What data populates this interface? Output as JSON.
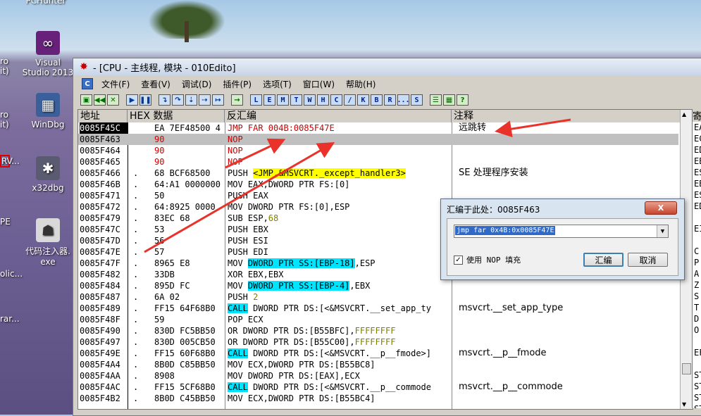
{
  "desktop": {
    "top_label": "PCHunter",
    "icons": [
      {
        "label": "Visual Studio 2013",
        "line1": "Visual",
        "line2": "Studio 2013"
      },
      {
        "label": "WinDbg"
      },
      {
        "label": "x32dbg"
      },
      {
        "label": "代码注入器.exe",
        "line1": "代码注入器.",
        "line2": "exe"
      }
    ],
    "left_edge_labels": [
      "ro",
      "it)",
      "ro",
      "it)",
      "RV...",
      "PE",
      "olic...",
      "rar..."
    ]
  },
  "window": {
    "title": "- [CPU - 主线程, 模块 - 010Edito]",
    "menu": [
      "文件(F)",
      "查看(V)",
      "调试(D)",
      "插件(P)",
      "选项(T)",
      "窗口(W)",
      "帮助(H)"
    ],
    "menu_icon": "C",
    "toolbar_letters": [
      "L",
      "E",
      "M",
      "T",
      "W",
      "H",
      "C",
      "/",
      "K",
      "B",
      "R",
      "...",
      "S"
    ]
  },
  "cpu": {
    "columns": {
      "address": "地址",
      "hex": "HEX 数据",
      "disasm": "反汇编",
      "comment": "注释"
    },
    "registers_header": "寄",
    "registers": [
      "EA",
      "EC",
      "ED",
      "EB",
      "ES",
      "EB",
      "ES",
      "ED",
      "",
      "EI",
      "",
      "C",
      "P",
      "A",
      "Z",
      "S",
      "T",
      "D",
      "O",
      "",
      "EF",
      "",
      "ST",
      "ST",
      "ST",
      "ST"
    ],
    "rows": [
      {
        "addr": "0085F45C",
        "dot": "",
        "hex": "EA 7EF48500 4",
        "dis": [
          {
            "t": "JMP FAR 004B:0085F47E",
            "c": "red"
          }
        ],
        "comment": "远跳转",
        "sel": true
      },
      {
        "addr": "0085F463",
        "dot": "",
        "hex": "90",
        "hexc": "red",
        "dis": [
          {
            "t": "NOP",
            "c": "red"
          }
        ],
        "comment": "",
        "gray": true
      },
      {
        "addr": "0085F464",
        "dot": "",
        "hex": "90",
        "hexc": "red",
        "dis": [
          {
            "t": "NOP",
            "c": "red"
          }
        ],
        "comment": ""
      },
      {
        "addr": "0085F465",
        "dot": "",
        "hex": "90",
        "hexc": "red",
        "dis": [
          {
            "t": "NOP",
            "c": "red"
          }
        ],
        "comment": ""
      },
      {
        "addr": "0085F466",
        "dot": ".",
        "hex": "68 BCF68500",
        "dis": [
          {
            "t": "PUSH "
          },
          {
            "t": "<JMP.&MSVCRT._except_handler3>",
            "c": "hl"
          }
        ],
        "comment": "SE 处理程序安装"
      },
      {
        "addr": "0085F46B",
        "dot": ".",
        "hex": "64:A1 0000000",
        "dis": [
          {
            "t": "MOV EAX,DWORD PTR FS:[0]"
          }
        ],
        "comment": ""
      },
      {
        "addr": "0085F471",
        "dot": ".",
        "hex": "50",
        "dis": [
          {
            "t": "PUSH EAX"
          }
        ],
        "comment": ""
      },
      {
        "addr": "0085F472",
        "dot": ".",
        "hex": "64:8925 0000",
        "dis": [
          {
            "t": "MOV DWORD PTR FS:[0],ESP"
          }
        ],
        "comment": ""
      },
      {
        "addr": "0085F479",
        "dot": ".",
        "hex": "83EC 68",
        "dis": [
          {
            "t": "SUB ESP,"
          },
          {
            "t": "68",
            "c": "olive"
          }
        ],
        "comment": ""
      },
      {
        "addr": "0085F47C",
        "dot": ".",
        "hex": "53",
        "dis": [
          {
            "t": "PUSH EBX"
          }
        ],
        "comment": ""
      },
      {
        "addr": "0085F47D",
        "dot": ".",
        "hex": "56",
        "dis": [
          {
            "t": "PUSH ESI"
          }
        ],
        "comment": ""
      },
      {
        "addr": "0085F47E",
        "dot": ".",
        "hex": "57",
        "dis": [
          {
            "t": "PUSH EDI"
          }
        ],
        "comment": ""
      },
      {
        "addr": "0085F47F",
        "dot": ".",
        "hex": "8965 E8",
        "dis": [
          {
            "t": "MOV "
          },
          {
            "t": "DWORD PTR SS:[EBP-18]",
            "c": "mem"
          },
          {
            "t": ",ESP"
          }
        ],
        "comment": ""
      },
      {
        "addr": "0085F482",
        "dot": ".",
        "hex": "33DB",
        "dis": [
          {
            "t": "XOR EBX,EBX"
          }
        ],
        "comment": ""
      },
      {
        "addr": "0085F484",
        "dot": ".",
        "hex": "895D FC",
        "dis": [
          {
            "t": "MOV "
          },
          {
            "t": "DWORD PTR SS:[EBP-4]",
            "c": "mem"
          },
          {
            "t": ",EBX"
          }
        ],
        "comment": ""
      },
      {
        "addr": "0085F487",
        "dot": ".",
        "hex": "6A 02",
        "dis": [
          {
            "t": "PUSH "
          },
          {
            "t": "2",
            "c": "olive"
          }
        ],
        "comment": ""
      },
      {
        "addr": "0085F489",
        "dot": ".",
        "hex": "FF15 64F68B0",
        "dis": [
          {
            "t": "CALL",
            "c": "call"
          },
          {
            "t": " DWORD PTR DS:[<&MSVCRT.__set_app_ty"
          }
        ],
        "comment": "msvcrt.__set_app_type"
      },
      {
        "addr": "0085F48F",
        "dot": ".",
        "hex": "59",
        "dis": [
          {
            "t": "POP ECX"
          }
        ],
        "comment": ""
      },
      {
        "addr": "0085F490",
        "dot": ".",
        "hex": "830D FC5BB50",
        "dis": [
          {
            "t": "OR DWORD PTR DS:[B55BFC],"
          },
          {
            "t": "FFFFFFFF",
            "c": "olive"
          }
        ],
        "comment": ""
      },
      {
        "addr": "0085F497",
        "dot": ".",
        "hex": "830D 005CB50",
        "dis": [
          {
            "t": "OR DWORD PTR DS:[B55C00],"
          },
          {
            "t": "FFFFFFFF",
            "c": "olive"
          }
        ],
        "comment": ""
      },
      {
        "addr": "0085F49E",
        "dot": ".",
        "hex": "FF15 60F68B0",
        "dis": [
          {
            "t": "CALL",
            "c": "call"
          },
          {
            "t": " DWORD PTR DS:[<&MSVCRT.__p__fmode>]"
          }
        ],
        "comment": "msvcrt.__p__fmode"
      },
      {
        "addr": "0085F4A4",
        "dot": ".",
        "hex": "8B0D C85BB50",
        "dis": [
          {
            "t": "MOV ECX,DWORD PTR DS:[B55BC8]"
          }
        ],
        "comment": ""
      },
      {
        "addr": "0085F4AA",
        "dot": ".",
        "hex": "8908",
        "dis": [
          {
            "t": "MOV DWORD PTR DS:[EAX],ECX"
          }
        ],
        "comment": ""
      },
      {
        "addr": "0085F4AC",
        "dot": ".",
        "hex": "FF15 5CF68B0",
        "dis": [
          {
            "t": "CALL",
            "c": "call"
          },
          {
            "t": " DWORD PTR DS:[<&MSVCRT.__p__commode"
          }
        ],
        "comment": "msvcrt.__p__commode"
      },
      {
        "addr": "0085F4B2",
        "dot": ".",
        "hex": "8B0D C45BB50",
        "dis": [
          {
            "t": "MOV ECX,DWORD PTR DS:[B55BC4]"
          }
        ],
        "comment": ""
      }
    ]
  },
  "dialog": {
    "title": "汇编于此处：0085F463",
    "close": "X",
    "input_value": "jmp far 0x4B:0x0085F47E",
    "checkbox_label": "使用 NOP 填充",
    "checkbox_checked": true,
    "assemble_button": "汇编",
    "cancel_button": "取消"
  },
  "colors": {
    "arrow": "#e8322a",
    "cyan": "#00e5ff",
    "yellow": "#ffff00",
    "selection": "#3169c6"
  }
}
